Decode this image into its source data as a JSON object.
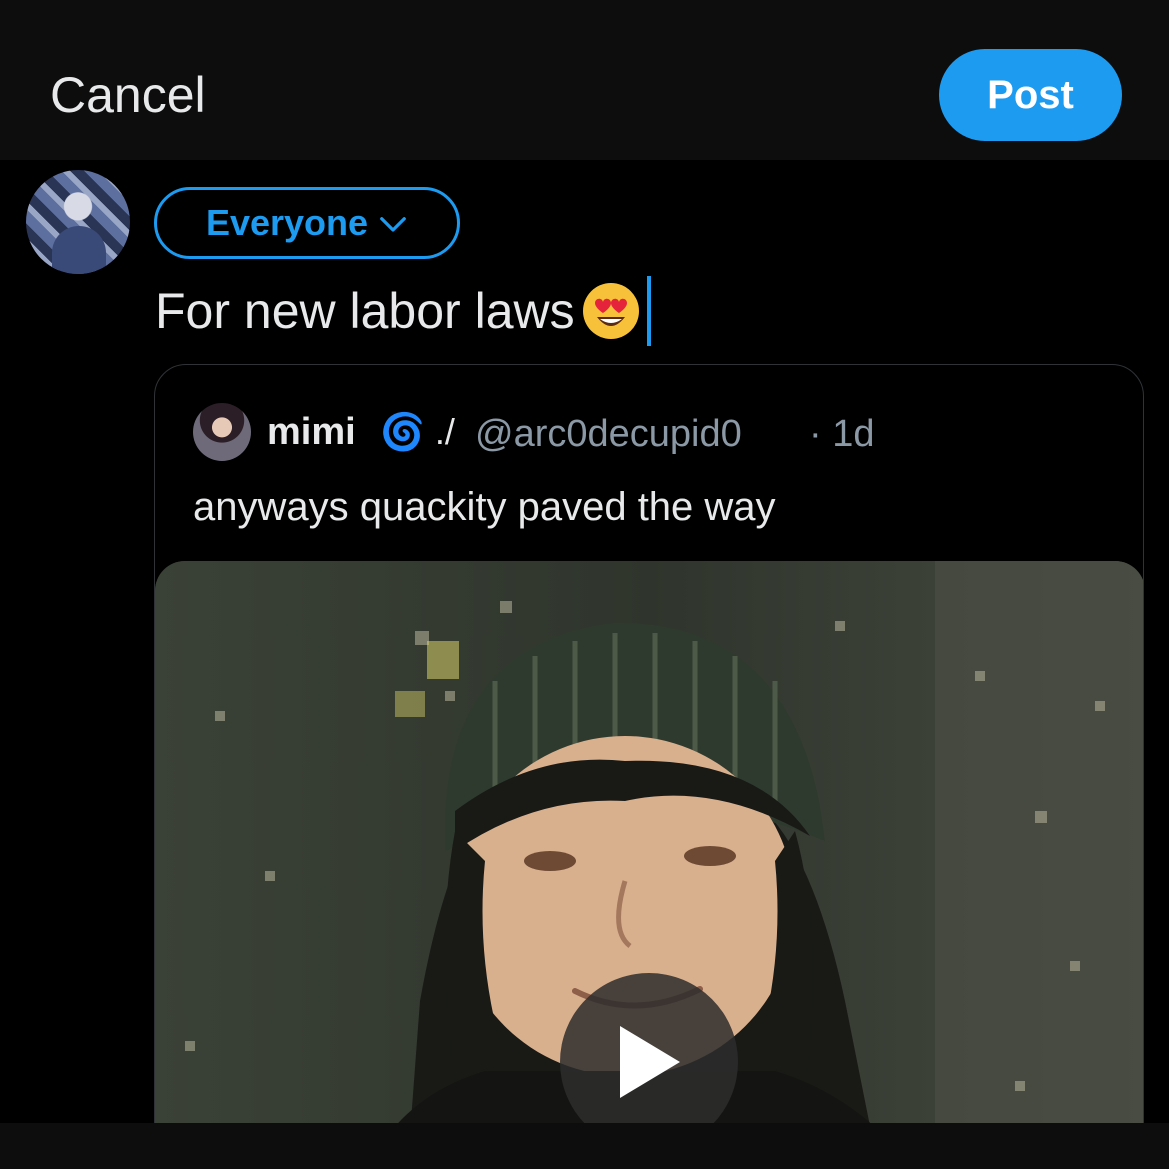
{
  "header": {
    "cancel_label": "Cancel",
    "post_label": "Post",
    "accent_color": "#1d9bf0"
  },
  "composer": {
    "audience_label": "Everyone",
    "audience_icon": "chevron-down-icon",
    "text": "For new labor laws",
    "emoji": "smiling-face-with-heart-eyes"
  },
  "quoted_post": {
    "author_name": "mimi",
    "author_name_suffix": "🌀 ./",
    "handle": "@arc0decupid0",
    "time": "· 1d",
    "text": "anyways quackity paved the way",
    "media_type": "video",
    "media_icon": "play-icon"
  }
}
